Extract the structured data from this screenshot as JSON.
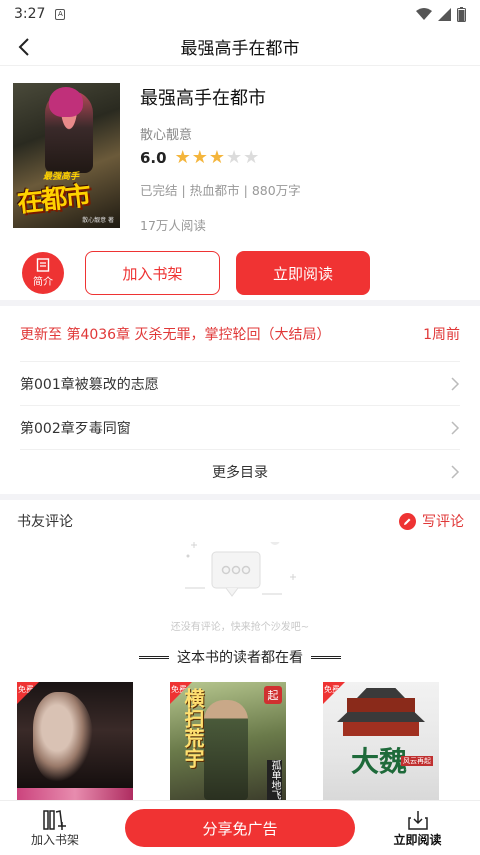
{
  "status_bar": {
    "time": "3:27"
  },
  "header": {
    "title": "最强高手在都市"
  },
  "book": {
    "title": "最强高手在都市",
    "author": "散心靓意",
    "score": "6.0",
    "stars": 3,
    "stars_max": 5,
    "tags": "已完结 | 热血都市 | 880万字",
    "readers": "17万人阅读",
    "cover_text": "在都市",
    "cover_top_text": "最强高手",
    "cover_author": "散心靓意 著"
  },
  "actions": {
    "intro_label": "简介",
    "add_shelf_label": "加入书架",
    "read_now_label": "立即阅读"
  },
  "chapters": {
    "latest_text": "更新至 第4036章 灭杀无罪，掌控轮回（大结局）",
    "latest_time": "1周前",
    "items": [
      "第001章被篡改的志愿",
      "第002章歹毒同窗"
    ],
    "more_label": "更多目录"
  },
  "reviews": {
    "title": "书友评论",
    "write_label": "写评论",
    "empty_text": "还没有评论，快来抢个沙发吧~"
  },
  "recommend": {
    "title": "这本书的读者都在看",
    "badge": "免费",
    "books": [
      {
        "cover_text": ""
      },
      {
        "cover_text": "横扫荒宇",
        "author": "孤单地飞",
        "tag": "起"
      },
      {
        "cover_text": "大魏",
        "subtitle": "风云再起"
      }
    ]
  },
  "bottom_bar": {
    "add_shelf_label": "加入书架",
    "share_label": "分享免广告",
    "read_label": "立即阅读"
  },
  "colors": {
    "accent": "#f03333",
    "star": "#f4b53c"
  }
}
